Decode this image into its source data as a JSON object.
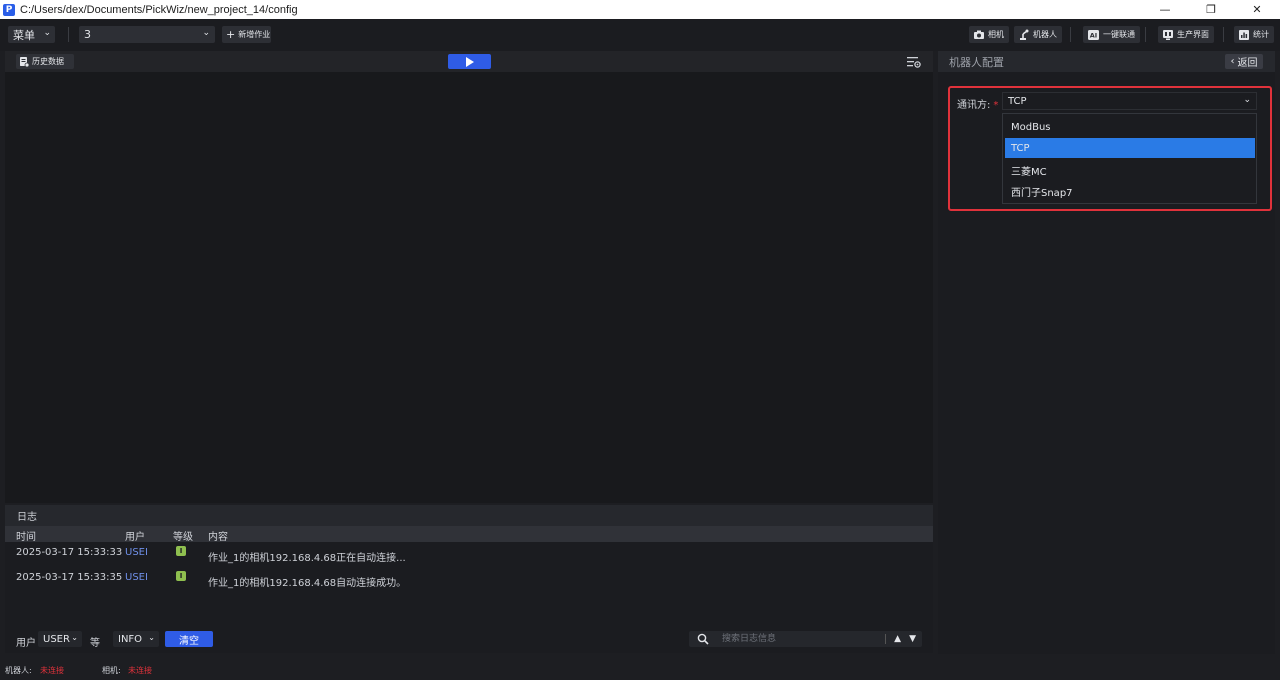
{
  "window": {
    "title": "C:/Users/dex/Documents/PickWiz/new_project_14/config",
    "app_icon_letter": "P",
    "minimize": "—",
    "restore": "❐",
    "close": "✕"
  },
  "toolbar": {
    "menu_label": "菜单",
    "job_value": "3",
    "add_job_label": "新增作业",
    "right_buttons": {
      "camera": "相机",
      "robot": "机器人",
      "one_click": "一键联通",
      "production": "生产界面",
      "stats": "统计"
    }
  },
  "main": {
    "history_label": "历史数据"
  },
  "log": {
    "header": "日志",
    "columns": {
      "time": "时间",
      "user": "用户",
      "level": "等级",
      "content": "内容"
    },
    "rows": [
      {
        "time": "2025-03-17 15:33:33",
        "user": "USEI",
        "level": "I",
        "content": "作业_1的相机192.168.4.68正在自动连接..."
      },
      {
        "time": "2025-03-17 15:33:35",
        "user": "USEI",
        "level": "I",
        "content": "作业_1的相机192.168.4.68自动连接成功。"
      }
    ],
    "footer": {
      "user_label": "用户",
      "user_value": "USER",
      "level_label": "等",
      "level_value": "INFO",
      "clear_label": "清空",
      "search_placeholder": "搜索日志信息"
    }
  },
  "config": {
    "title": "机器人配置",
    "back_label": "返回",
    "comm_label": "通讯方:",
    "comm_required_mark": "*",
    "comm_value": "TCP",
    "options": [
      "ModBus",
      "TCP",
      "三菱MC",
      "西门子Snap7"
    ],
    "selected_index": 1,
    "highlight_color": "#e0323b",
    "selected_color": "#2a7be6"
  },
  "status": {
    "robot_label": "机器人:",
    "robot_value": "未连接",
    "camera_label": "相机:",
    "camera_value": "未连接"
  }
}
